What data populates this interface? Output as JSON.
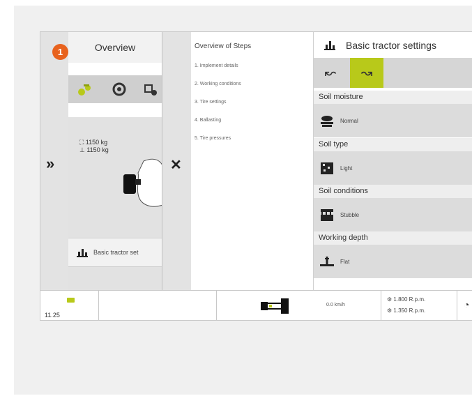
{
  "badge": "1",
  "overview_tab": "Overview",
  "left_icons": [
    "tractor-settings-icon",
    "tire-icon",
    "ballast-icon"
  ],
  "weights": {
    "front": "1150 kg",
    "rear": "1150 kg"
  },
  "basic_button": "Basic tractor set",
  "steps": {
    "title": "Overview of Steps",
    "items": [
      "1. Implement details",
      "2. Working conditions",
      "3. Tire settings",
      "4. Ballasting",
      "5. Tire pressures"
    ]
  },
  "settings": {
    "title": "Basic tractor settings",
    "sections": [
      {
        "label": "Soil moisture",
        "value": "Normal"
      },
      {
        "label": "Soil type",
        "value": "Light"
      },
      {
        "label": "Soil conditions",
        "value": "Stubble"
      },
      {
        "label": "Working depth",
        "value": "Flat"
      }
    ]
  },
  "status": {
    "time": "11.25",
    "speed": "0.0 km/h",
    "rpm1": "1.800 R.p.m.",
    "rpm2": "1.350 R.p.m."
  },
  "colors": {
    "accent": "#b8c91a",
    "badge": "#e8621d"
  }
}
